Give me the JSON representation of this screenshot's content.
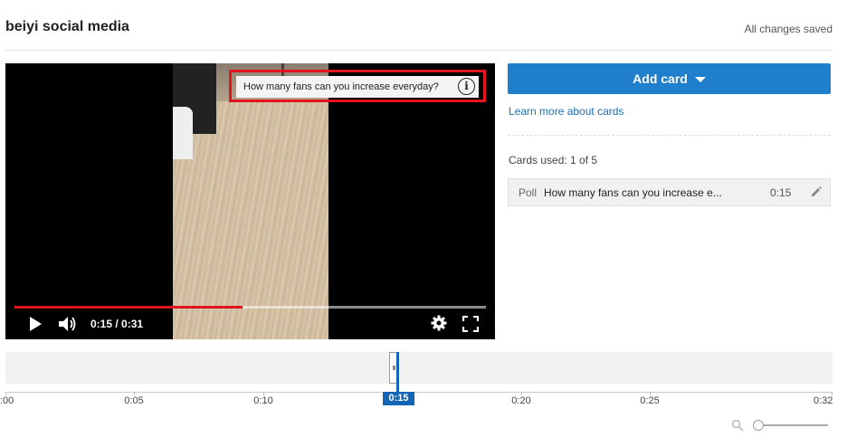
{
  "header": {
    "title": "beiyi social media",
    "status": "All changes saved"
  },
  "player": {
    "card_teaser_text": "How many fans can you increase everyday?",
    "info_icon": "info-icon",
    "current_time": "0:15 / 0:31",
    "progress_fraction": 0.484,
    "accent_color": "#e3141d"
  },
  "panel": {
    "add_card_label": "Add card",
    "learn_more_label": "Learn more about cards",
    "cards_used_label": "Cards used: 1 of 5",
    "card": {
      "type": "Poll",
      "title": "How many fans can you increase e...",
      "time": "0:15"
    },
    "button_color": "#1f7fcc"
  },
  "timeline": {
    "ticks": [
      ":00",
      "0:05",
      "0:10",
      "0:15",
      "0:20",
      "0:25",
      "0:32"
    ],
    "playhead_label": "0:15",
    "playhead_color": "#1565b5"
  }
}
